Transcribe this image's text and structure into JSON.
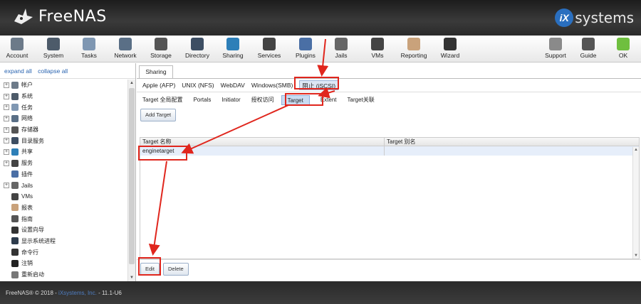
{
  "header": {
    "app_name": "FreeNAS",
    "vendor_badge": "iX",
    "vendor_name": "systems"
  },
  "toolbar": [
    {
      "label": "Account",
      "icon": "account-icon",
      "color": "#6c7a89"
    },
    {
      "label": "System",
      "icon": "system-icon",
      "color": "#4d5b6a"
    },
    {
      "label": "Tasks",
      "icon": "tasks-icon",
      "color": "#7f97b2"
    },
    {
      "label": "Network",
      "icon": "network-icon",
      "color": "#5a6f86"
    },
    {
      "label": "Storage",
      "icon": "storage-icon",
      "color": "#555555"
    },
    {
      "label": "Directory",
      "icon": "directory-icon",
      "color": "#3d4e63"
    },
    {
      "label": "Sharing",
      "icon": "sharing-icon",
      "color": "#2d7fb8"
    },
    {
      "label": "Services",
      "icon": "services-icon",
      "color": "#444444"
    },
    {
      "label": "Plugins",
      "icon": "plugins-icon",
      "color": "#4a6fa5"
    },
    {
      "label": "Jails",
      "icon": "jails-icon",
      "color": "#666666"
    },
    {
      "label": "VMs",
      "icon": "vms-icon",
      "color": "#444444"
    },
    {
      "label": "Reporting",
      "icon": "reporting-icon",
      "color": "#c9a27b"
    },
    {
      "label": "Wizard",
      "icon": "wizard-icon",
      "color": "#333333"
    },
    {
      "label": "Support",
      "icon": "support-icon",
      "color": "#8a8a8a"
    },
    {
      "label": "Guide",
      "icon": "guide-icon",
      "color": "#555555"
    },
    {
      "label": "OK",
      "icon": "ok-icon",
      "color": "#6fbf3f"
    }
  ],
  "left_pane": {
    "expand_all": "expand all",
    "collapse_all": "collapse all",
    "tree": [
      {
        "label": "帐户",
        "expandable": true,
        "icon": "account-icon"
      },
      {
        "label": "系统",
        "expandable": true,
        "icon": "system-icon"
      },
      {
        "label": "任务",
        "expandable": true,
        "icon": "tasks-icon"
      },
      {
        "label": "网络",
        "expandable": true,
        "icon": "network-icon"
      },
      {
        "label": "存储器",
        "expandable": true,
        "icon": "storage-icon"
      },
      {
        "label": "目录服务",
        "expandable": true,
        "icon": "directory-icon"
      },
      {
        "label": "共享",
        "expandable": true,
        "icon": "sharing-icon"
      },
      {
        "label": "服务",
        "expandable": true,
        "icon": "services-icon"
      },
      {
        "label": "插件",
        "expandable": false,
        "icon": "plugins-icon"
      },
      {
        "label": "Jails",
        "expandable": true,
        "icon": "jails-icon"
      },
      {
        "label": "VMs",
        "expandable": false,
        "icon": "vms-icon"
      },
      {
        "label": "报表",
        "expandable": false,
        "icon": "reporting-icon"
      },
      {
        "label": "指南",
        "expandable": false,
        "icon": "guide-icon"
      },
      {
        "label": "设置向导",
        "expandable": false,
        "icon": "wizard-icon"
      },
      {
        "label": "显示系统进程",
        "expandable": false,
        "icon": "processes-icon"
      },
      {
        "label": "命令行",
        "expandable": false,
        "icon": "shell-icon"
      },
      {
        "label": "注销",
        "expandable": false,
        "icon": "logout-icon"
      },
      {
        "label": "重新启动",
        "expandable": false,
        "icon": "reboot-icon"
      }
    ]
  },
  "main": {
    "sharing_tab": "Sharing",
    "share_tabs": [
      "Apple (AFP)",
      "UNIX (NFS)",
      "WebDAV",
      "Windows(SMB)",
      "阻止 (iSCSI)"
    ],
    "iscsi_tabs": [
      "Target 全局配置",
      "Portals",
      "Initiator",
      "授权访问",
      "Target",
      "Extent",
      "Target关联"
    ],
    "add_button": "Add Target",
    "table": {
      "columns": [
        "Target 名称",
        "Target 别名"
      ],
      "rows": [
        [
          "enginetarget",
          ""
        ]
      ]
    },
    "edit_button": "Edit",
    "delete_button": "Delete"
  },
  "footer": {
    "prefix": "FreeNAS® © 2018 - ",
    "link": "iXsystems, Inc.",
    "suffix": " - 11.1-U6"
  },
  "colors": {
    "annotation": "#e0261d",
    "link": "#2a64b0",
    "selected_row": "#e6eefa"
  }
}
